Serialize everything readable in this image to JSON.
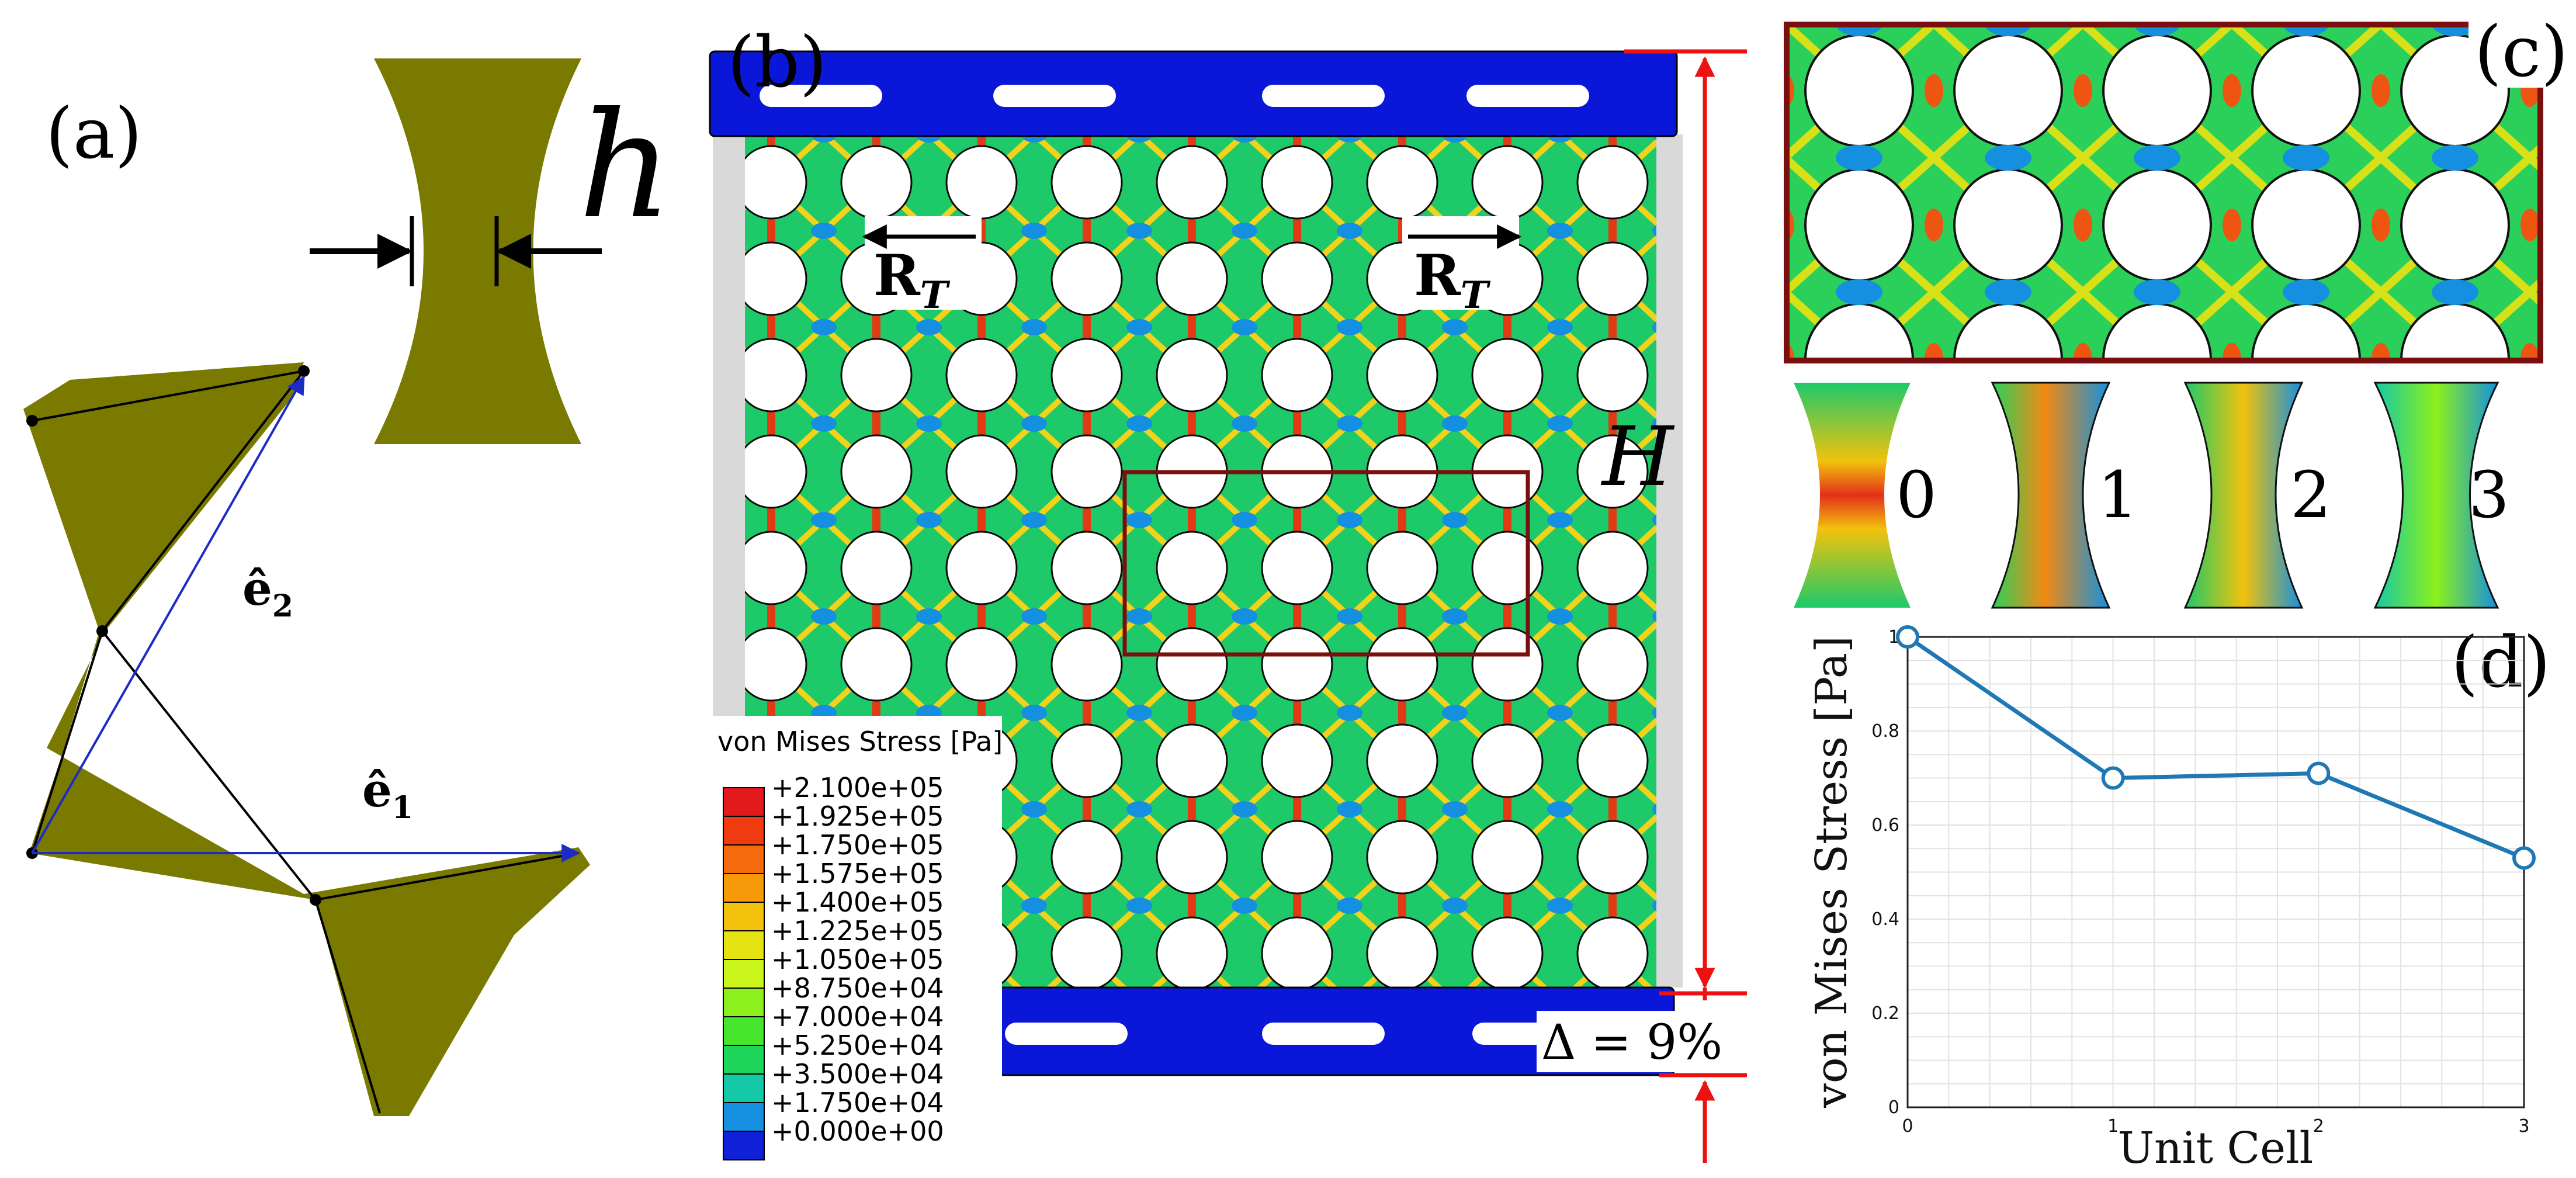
{
  "panels": {
    "a": {
      "label": "(a)",
      "h_symbol": "h",
      "e1_symbol": "ê",
      "e1_sub": "1",
      "e2_symbol": "ê",
      "e2_sub": "2"
    },
    "b": {
      "label": "(b)",
      "rt_symbol": "R",
      "rt_sub": "T",
      "H_symbol": "H",
      "delta_text": "Δ = 9%"
    },
    "c": {
      "label": "(c)",
      "cells": [
        "0",
        "1",
        "2",
        "3"
      ]
    },
    "d": {
      "label": "(d)"
    }
  },
  "legend": {
    "title": "von Mises Stress [Pa]",
    "entries": [
      {
        "value": "+2.100e+05",
        "color": "#e31a1c"
      },
      {
        "value": "+1.925e+05",
        "color": "#f03b10"
      },
      {
        "value": "+1.750e+05",
        "color": "#f56a0c"
      },
      {
        "value": "+1.575e+05",
        "color": "#f79a0a"
      },
      {
        "value": "+1.400e+05",
        "color": "#f2c20c"
      },
      {
        "value": "+1.225e+05",
        "color": "#e6e312"
      },
      {
        "value": "+1.050e+05",
        "color": "#c9f51a"
      },
      {
        "value": "+8.750e+04",
        "color": "#8cf01c"
      },
      {
        "value": "+7.000e+04",
        "color": "#46e62c"
      },
      {
        "value": "+5.250e+04",
        "color": "#1ed65a"
      },
      {
        "value": "+3.500e+04",
        "color": "#16c9a6"
      },
      {
        "value": "+1.750e+04",
        "color": "#1590e0"
      },
      {
        "value": "+0.000e+00",
        "color": "#1020d8"
      }
    ]
  },
  "colors": {
    "olive": "#7a7a00",
    "platen_blue": "#0b17d8",
    "frame_red": "#7a0f0f",
    "arrow_red": "#ee1111",
    "series_blue": "#1f77b4"
  },
  "chart_data": {
    "type": "line",
    "xlabel": "Unit Cell",
    "ylabel": "von Mises Stress [Pa]",
    "x": [
      0,
      1,
      2,
      3
    ],
    "series": [
      {
        "values": [
          1.0,
          0.7,
          0.71,
          0.53
        ]
      }
    ],
    "xlim": [
      0,
      3
    ],
    "ylim": [
      0,
      1
    ],
    "xticks": [
      "0",
      "1",
      "2",
      "3"
    ],
    "yticks": [
      "0",
      "0.2",
      "0.4",
      "0.6",
      "0.8",
      "1"
    ],
    "grid": true,
    "marker": "circle"
  }
}
